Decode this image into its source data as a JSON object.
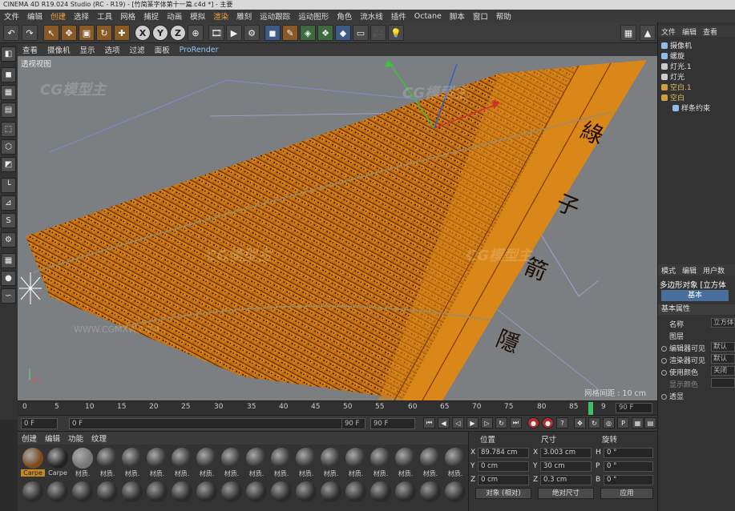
{
  "window": {
    "title": "CINEMA 4D R19.024 Studio (RC - R19) - [竹简篆字体第十一篇.c4d *] - 主要"
  },
  "menu": [
    "文件",
    "编辑",
    "创建",
    "选择",
    "工具",
    "网格",
    "捕捉",
    "动画",
    "模拟",
    "渲染",
    "雕刻",
    "运动跟踪",
    "运动图形",
    "角色",
    "流水线",
    "插件",
    "Octane",
    "脚本",
    "窗口",
    "帮助"
  ],
  "toolbar": {
    "undo_icon": "undo-icon",
    "tools": [
      "move",
      "scale",
      "rotate",
      "add"
    ],
    "axes": [
      "X",
      "Y",
      "Z"
    ]
  },
  "viewport_menu": [
    "查看",
    "摄像机",
    "显示",
    "选项",
    "过滤",
    "面板",
    "ProRender"
  ],
  "viewport": {
    "label": "透视视图",
    "grid_label": "网格间距 : 10 cm",
    "watermarks": [
      "CG模型主",
      "CG模型主",
      "CG模型主",
      "CG模型主"
    ],
    "watermark_url": "WWW.CGMXW.COM"
  },
  "timeline": {
    "ticks": [
      "0",
      "5",
      "10",
      "15",
      "20",
      "25",
      "30",
      "35",
      "40",
      "45",
      "50",
      "55",
      "60",
      "65",
      "70",
      "75",
      "80",
      "85",
      "9"
    ],
    "end_frame": "90 F",
    "current_frame": "0 F",
    "start_field": "0 F",
    "min_field": "90 F",
    "max_field": "90 F"
  },
  "materials": {
    "tabs": [
      "创建",
      "编辑",
      "功能",
      "纹理"
    ],
    "row1_labels": [
      "Carpe",
      "Carpe",
      "材质.",
      "材质.",
      "材质.",
      "材质.",
      "材质.",
      "材质.",
      "材质.",
      "材质.",
      "材质.",
      "材质.",
      "材质.",
      "材质.",
      "材质.",
      "材质.",
      "材质.",
      "材质."
    ],
    "row1_colors": [
      "#7a4a1c",
      "#222222",
      "#777777",
      "#333333",
      "#333333",
      "#333333",
      "#333333",
      "#333333",
      "#333333",
      "#333333",
      "#333333",
      "#333333",
      "#333333",
      "#333333",
      "#333333",
      "#333333",
      "#333333",
      "#333333"
    ]
  },
  "coords": {
    "headers": [
      "位置",
      "尺寸",
      "旋转"
    ],
    "position": {
      "x": "89.784 cm",
      "y": "0 cm",
      "z": "0 cm"
    },
    "size": {
      "x": "3.003 cm",
      "y": "30 cm",
      "z": "0.3 cm"
    },
    "rotation": {
      "h": "0 °",
      "p": "0 °",
      "b": "0 °"
    },
    "axis_labels": {
      "x": "X",
      "y": "Y",
      "z": "Z",
      "h": "H",
      "p": "P",
      "b": "B"
    },
    "mode_left": "对象 (相对)",
    "mode_right": "绝对尺寸",
    "apply": "应用"
  },
  "object_manager": {
    "tabs": [
      "文件",
      "编辑",
      "查看"
    ],
    "items": [
      {
        "label": "摄像机",
        "color": "#8fbcea",
        "selected": false,
        "yellow": false
      },
      {
        "label": "螺旋",
        "color": "#8fbcea",
        "selected": false,
        "yellow": false
      },
      {
        "label": "灯光.1",
        "color": "#cccccc",
        "selected": false,
        "yellow": false
      },
      {
        "label": "灯光",
        "color": "#cccccc",
        "selected": false,
        "yellow": false
      },
      {
        "label": "空白.1",
        "color": "#d0a040",
        "selected": false,
        "yellow": true
      },
      {
        "label": "空白",
        "color": "#d0a040",
        "selected": false,
        "yellow": true
      },
      {
        "label": "样条约束",
        "color": "#8fbcea",
        "selected": false,
        "yellow": false
      }
    ]
  },
  "attributes": {
    "tabs": [
      "模式",
      "编辑",
      "用户数"
    ],
    "object": "多边形对象 [立方体",
    "basic_tab": "基本",
    "section": "基本属性",
    "rows": [
      {
        "label": "名称",
        "value": "立方体",
        "radio": false
      },
      {
        "label": "图层",
        "value": "",
        "radio": false
      },
      {
        "label": "编辑器可见",
        "value": "默认",
        "radio": true
      },
      {
        "label": "渲染器可见",
        "value": "默认",
        "radio": true
      },
      {
        "label": "使用颜色",
        "value": "关闭",
        "radio": true
      },
      {
        "label": "显示颜色",
        "value": "",
        "radio": false
      },
      {
        "label": "透显",
        "value": "",
        "radio": true
      }
    ]
  }
}
